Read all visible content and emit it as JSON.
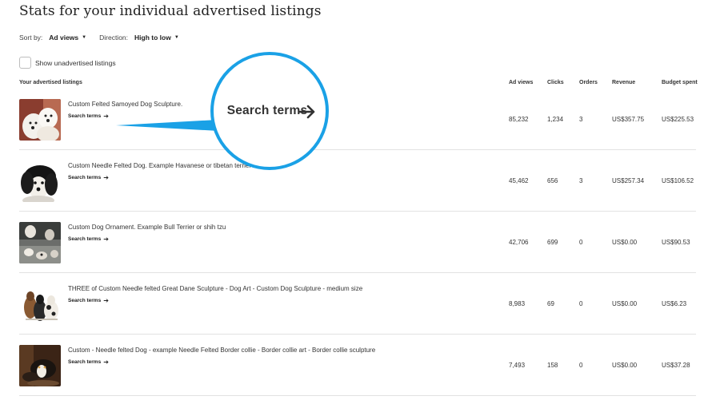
{
  "page": {
    "title": "Stats for your individual advertised listings"
  },
  "sort": {
    "sort_by_label": "Sort by:",
    "sort_by_value": "Ad views",
    "direction_label": "Direction:",
    "direction_value": "High to low"
  },
  "filter": {
    "show_unadvertised_label": "Show unadvertised listings",
    "checked": false
  },
  "table": {
    "headers": {
      "listings": "Your advertised listings",
      "ad_views": "Ad views",
      "clicks": "Clicks",
      "orders": "Orders",
      "revenue": "Revenue",
      "budget_spent": "Budget spent"
    },
    "search_terms_label": "Search terms",
    "rows": [
      {
        "title": "Custom Felted Samoyed Dog Sculpture.",
        "ad_views": "85,232",
        "clicks": "1,234",
        "orders": "3",
        "revenue": "US$357.75",
        "budget_spent": "US$225.53"
      },
      {
        "title": "Custom Needle Felted Dog. Example Havanese or tibetan terrier",
        "ad_views": "45,462",
        "clicks": "656",
        "orders": "3",
        "revenue": "US$257.34",
        "budget_spent": "US$106.52"
      },
      {
        "title": "Custom Dog Ornament. Example Bull Terrier or shih tzu",
        "ad_views": "42,706",
        "clicks": "699",
        "orders": "0",
        "revenue": "US$0.00",
        "budget_spent": "US$90.53"
      },
      {
        "title": "THREE of Custom Needle felted Great Dane Sculpture - Dog Art - Custom Dog Sculpture - medium size",
        "ad_views": "8,983",
        "clicks": "69",
        "orders": "0",
        "revenue": "US$0.00",
        "budget_spent": "US$6.23"
      },
      {
        "title": "Custom - Needle felted Dog - example Needle Felted Border collie - Border collie art - Border collie sculpture",
        "ad_views": "7,493",
        "clicks": "158",
        "orders": "0",
        "revenue": "US$0.00",
        "budget_spent": "US$37.28"
      }
    ]
  },
  "callout": {
    "label": "Search terms",
    "color": "#1aa1e6"
  },
  "icons": {
    "caret": "caret-down-icon",
    "arrow": "arrow-right-icon"
  }
}
